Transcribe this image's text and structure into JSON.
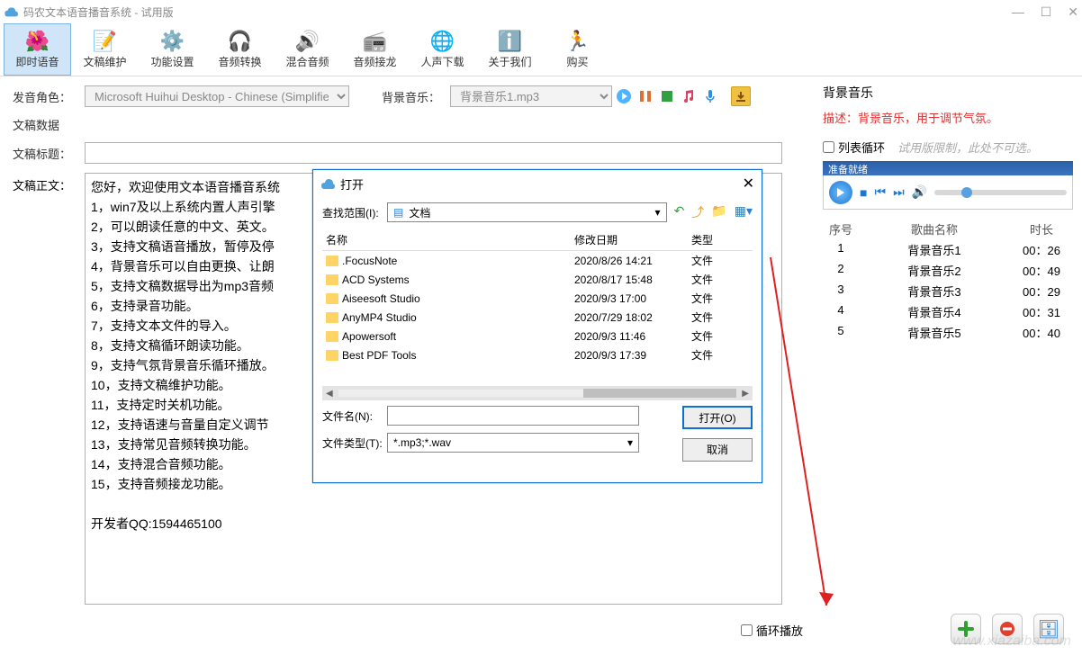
{
  "window": {
    "title": "码农文本语音播音系统 - 试用版"
  },
  "toolbar": {
    "instant_voice": "即时语音",
    "manuscript_maintain": "文稿维护",
    "function_settings": "功能设置",
    "audio_convert": "音频转换",
    "mix_audio": "混合音频",
    "audio_relay": "音频接龙",
    "voice_download": "人声下载",
    "about_us": "关于我们",
    "buy": "购买"
  },
  "form": {
    "voice_label": "发音角色：",
    "voice_value": "Microsoft Huihui Desktop - Chinese (Simplifie",
    "bgm_label": "背景音乐：",
    "bgm_value": "背景音乐1.mp3",
    "data_section": "文稿数据",
    "title_label": "文稿标题：",
    "title_value": "",
    "body_label": "文稿正文：",
    "body_value": "您好，欢迎使用文本语音播音系统\n1，win7及以上系统内置人声引擎\n2，可以朗读任意的中文、英文。\n3，支持文稿语音播放，暂停及停\n4，背景音乐可以自由更换、让朗\n5，支持文稿数据导出为mp3音频\n6，支持录音功能。\n7，支持文本文件的导入。\n8，支持文稿循环朗读功能。\n9，支持气氛背景音乐循环播放。\n10，支持文稿维护功能。\n11，支持定时关机功能。\n12，支持语速与音量自定义调节\n13，支持常见音频转换功能。\n14，支持混合音频功能。\n15，支持音频接龙功能。\n\n开发者QQ:1594465100",
    "loop_label": "循环播放"
  },
  "right_panel": {
    "title": "背景音乐",
    "desc": "描述：背景音乐，用于调节气氛。",
    "loop_list": "列表循环",
    "trial_hint": "试用版限制，此处不可选。",
    "player_status": "准备就绪",
    "headers": {
      "num": "序号",
      "name": "歌曲名称",
      "dur": "时长"
    },
    "songs": [
      {
        "num": "1",
        "name": "背景音乐1",
        "dur": "00：26"
      },
      {
        "num": "2",
        "name": "背景音乐2",
        "dur": "00：49"
      },
      {
        "num": "3",
        "name": "背景音乐3",
        "dur": "00：29"
      },
      {
        "num": "4",
        "name": "背景音乐4",
        "dur": "00：31"
      },
      {
        "num": "5",
        "name": "背景音乐5",
        "dur": "00：40"
      }
    ]
  },
  "dialog": {
    "title": "打开",
    "scope_label": "查找范围(I):",
    "scope_value": "文档",
    "hdr_name": "名称",
    "hdr_date": "修改日期",
    "hdr_type": "类型",
    "files": [
      {
        "name": ".FocusNote",
        "date": "2020/8/26 14:21",
        "type": "文件"
      },
      {
        "name": "ACD Systems",
        "date": "2020/8/17 15:48",
        "type": "文件"
      },
      {
        "name": "Aiseesoft Studio",
        "date": "2020/9/3 17:00",
        "type": "文件"
      },
      {
        "name": "AnyMP4 Studio",
        "date": "2020/7/29 18:02",
        "type": "文件"
      },
      {
        "name": "Apowersoft",
        "date": "2020/9/3 11:46",
        "type": "文件"
      },
      {
        "name": "Best PDF Tools",
        "date": "2020/9/3 17:39",
        "type": "文件"
      }
    ],
    "filename_label": "文件名(N):",
    "filename_value": "",
    "filetype_label": "文件类型(T):",
    "filetype_value": "*.mp3;*.wav",
    "open_btn": "打开(O)",
    "cancel_btn": "取消"
  },
  "watermark": "www.xiazaiba.com"
}
